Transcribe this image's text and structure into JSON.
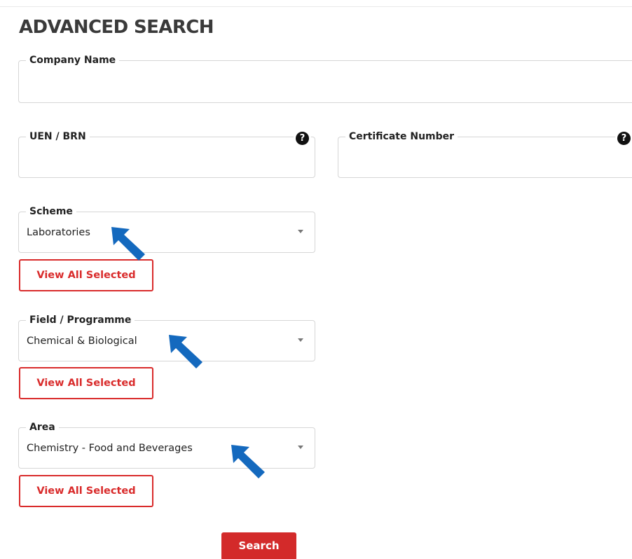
{
  "page": {
    "title": "ADVANCED SEARCH"
  },
  "form": {
    "company_name": {
      "label": "Company Name",
      "value": ""
    },
    "uen_brn": {
      "label": "UEN / BRN",
      "value": "",
      "help_icon": "?"
    },
    "certificate_number": {
      "label": "Certificate Number",
      "value": "",
      "help_icon": "?"
    },
    "scheme": {
      "label": "Scheme",
      "value": "Laboratories",
      "view_all_label": "View All Selected"
    },
    "field_programme": {
      "label": "Field / Programme",
      "value": "Chemical & Biological",
      "view_all_label": "View All Selected"
    },
    "area": {
      "label": "Area",
      "value": "Chemistry - Food and Beverages",
      "view_all_label": "View All Selected"
    },
    "search_label": "Search"
  },
  "annotations": {
    "arrow_color": "#1469be",
    "arrow_icon": "pointer-arrow-icon"
  },
  "colors": {
    "accent_red": "#d92b2b",
    "text": "#222222"
  }
}
